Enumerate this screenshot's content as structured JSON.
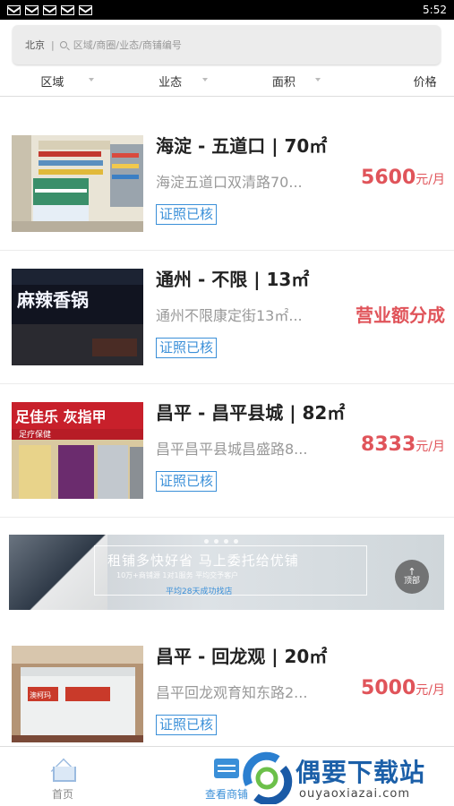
{
  "status_bar": {
    "time": "5:52",
    "notification_icons": [
      "mail-icon",
      "mail-icon",
      "mail-icon",
      "mail-icon",
      "mail-icon"
    ]
  },
  "search": {
    "city": "北京",
    "divider": "|",
    "placeholder": "区域/商圈/业态/商铺编号"
  },
  "filters": [
    {
      "label": "区域"
    },
    {
      "label": "业态"
    },
    {
      "label": "面积"
    },
    {
      "label": "价格"
    }
  ],
  "listings": [
    {
      "title": "海淀 - 五道口 | 70㎡",
      "address": "海淀五道口双清路70...",
      "price": "5600",
      "unit": "元/月",
      "badge": "证照已核"
    },
    {
      "title": "通州 - 不限 | 13㎡",
      "address": "通州不限康定街13㎡...",
      "price_text": "营业额分成",
      "badge": "证照已核",
      "thumb_sign": "麻辣香锅"
    },
    {
      "title": "昌平 - 昌平县城 | 82㎡",
      "address": "昌平昌平县城昌盛路8...",
      "price": "8333",
      "unit": "元/月",
      "badge": "证照已核",
      "thumb_sign": "足佳乐 灰指甲",
      "thumb_sub": "足疗保健"
    },
    {
      "title": "昌平 - 回龙观 | 20㎡",
      "address": "昌平回龙观育知东路2...",
      "price": "5000",
      "unit": "元/月",
      "badge": "证照已核",
      "thumb_sign": "澳柯玛"
    }
  ],
  "banner": {
    "title": "租铺多快好省  马上委托给优铺",
    "sub": "10万+商铺源   1对1服务   平均交予客户",
    "line": "平均28天成功找店"
  },
  "back_to_top": {
    "label": "顶部"
  },
  "bottom_nav": [
    {
      "label": "首页",
      "icon": "home-icon"
    },
    {
      "label": "查看商铺",
      "icon": "list-icon"
    }
  ],
  "watermark": {
    "title": "偶要下载站",
    "url": "ouyaoxiazai.com"
  },
  "colors": {
    "accent": "#3a8fd8",
    "price": "#e0545a"
  }
}
